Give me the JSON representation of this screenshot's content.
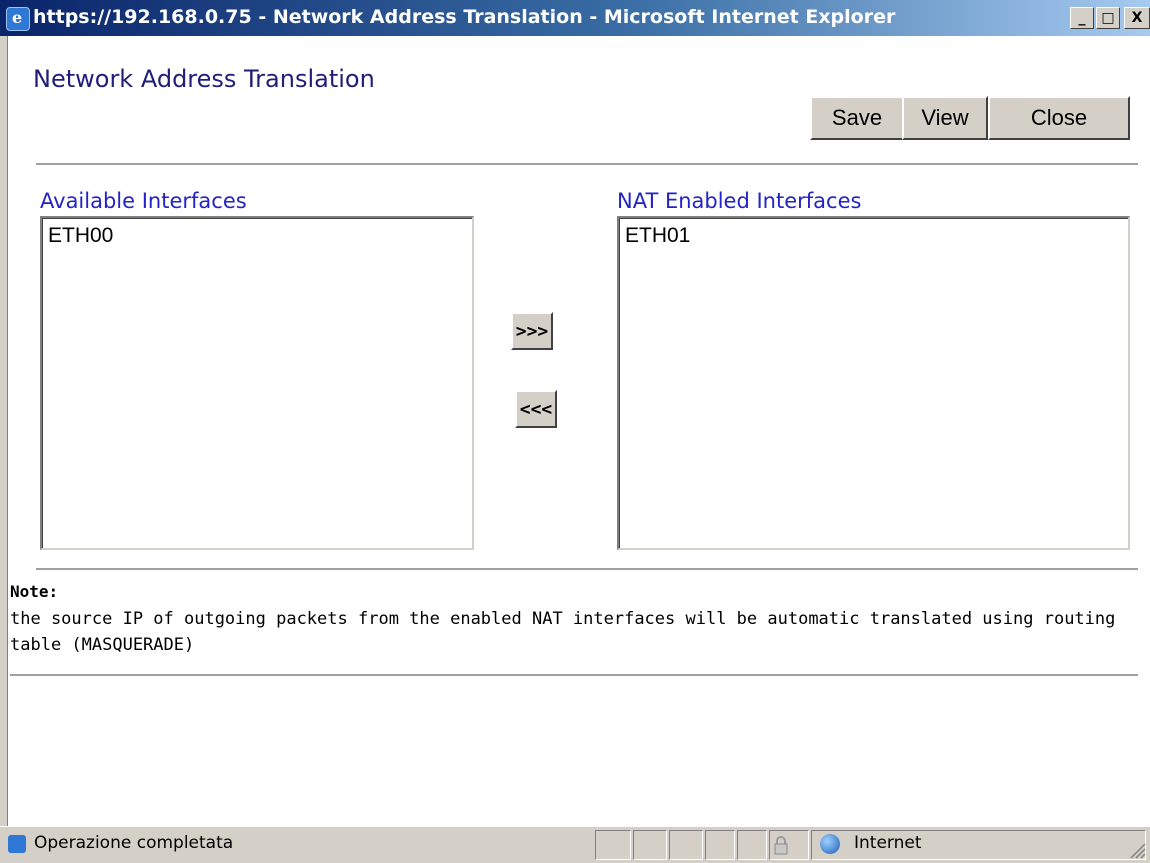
{
  "window": {
    "title": "https://192.168.0.75 - Network Address Translation - Microsoft Internet Explorer",
    "minimize_glyph": "_",
    "maximize_glyph": "□",
    "close_glyph": "X",
    "icon": "ie-icon"
  },
  "header": {
    "title": "Network Address Translation",
    "buttons": {
      "save": "Save",
      "view": "View",
      "close": "Close"
    }
  },
  "available": {
    "label": "Available Interfaces",
    "items": [
      "ETH00"
    ]
  },
  "nat_enabled": {
    "label": "NAT Enabled Interfaces",
    "items": [
      "ETH01"
    ]
  },
  "transfer": {
    "add": ">>>",
    "remove": "<<<"
  },
  "note": {
    "title": "Note:",
    "text": "the source IP of outgoing packets from the enabled NAT interfaces will be automatic translated using routing table (MASQUERADE)"
  },
  "statusbar": {
    "status": "Operazione completata",
    "zone": "Internet",
    "icons": [
      "ie-page-icon",
      "lock-icon",
      "globe-icon"
    ]
  },
  "colors": {
    "title_text": "#1f1f7a",
    "label_text": "#2323c8",
    "chrome": "#d4d0c8"
  }
}
